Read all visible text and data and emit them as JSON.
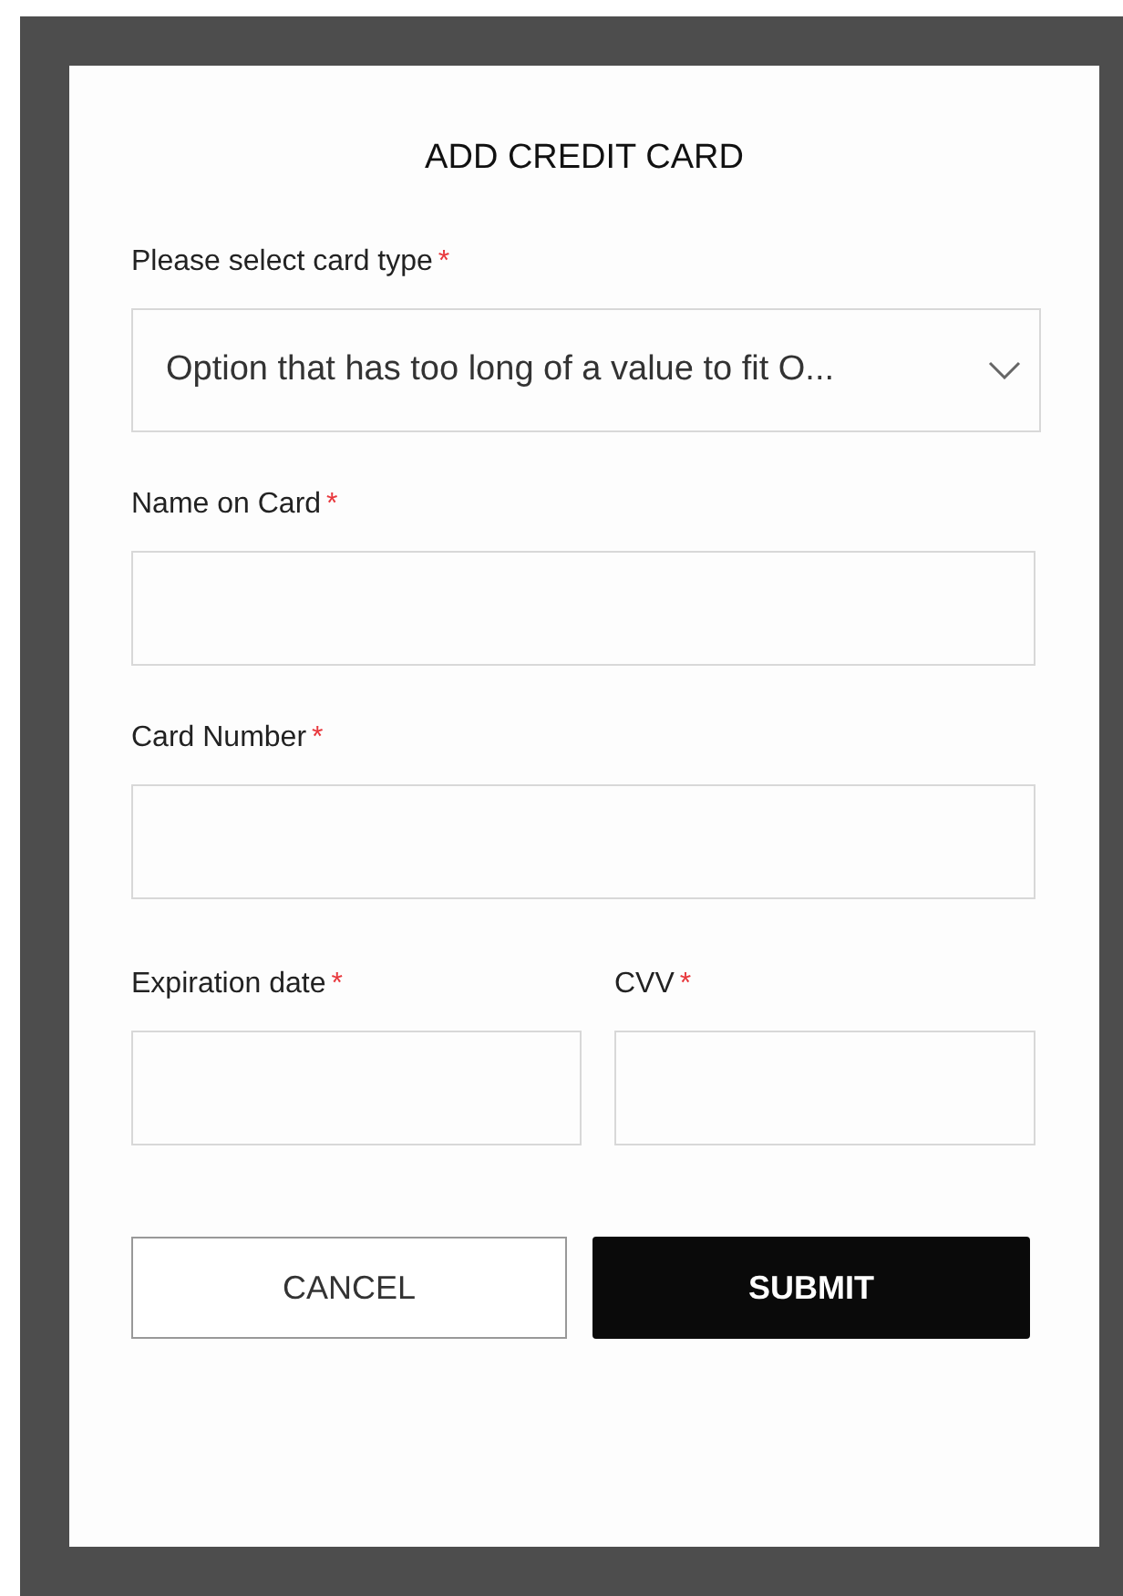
{
  "dialog": {
    "title": "ADD CREDIT CARD",
    "fields": [
      {
        "kind": "select",
        "label": "Please select card type",
        "required_mark": "*",
        "value": "Option that has too long of a value to fit O..."
      },
      {
        "kind": "text",
        "label": "Name on Card",
        "required_mark": "*"
      },
      {
        "kind": "text",
        "label": "Card Number",
        "required_mark": "*"
      }
    ],
    "pair_fields": [
      {
        "kind": "text",
        "label": "Expiration date",
        "required_mark": "*"
      },
      {
        "kind": "text",
        "label": "CVV",
        "required_mark": "*"
      }
    ],
    "buttons": [
      {
        "kind": "secondary",
        "label": "CANCEL"
      },
      {
        "kind": "primary",
        "label": "SUBMIT"
      }
    ]
  }
}
